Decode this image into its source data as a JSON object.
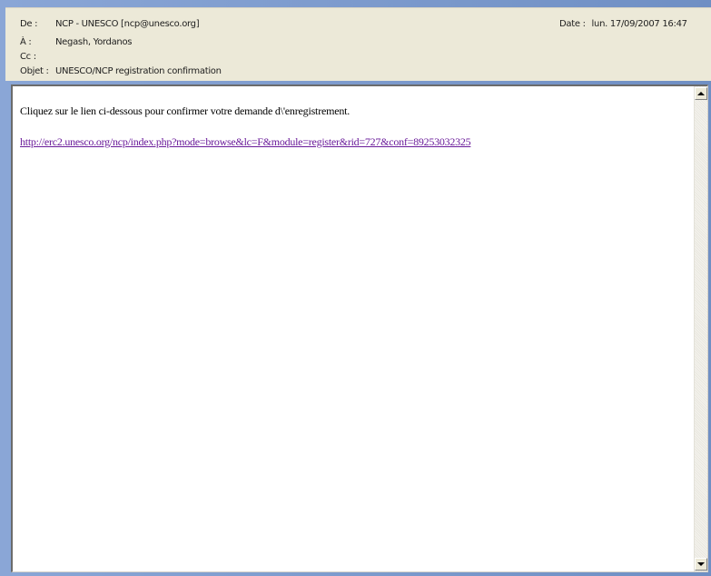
{
  "header": {
    "from_label": "De :",
    "from_value": "NCP - UNESCO [ncp@unesco.org]",
    "to_label": "À :",
    "to_value": "Negash, Yordanos",
    "cc_label": "Cc :",
    "cc_value": "",
    "subject_label": "Objet :",
    "subject_value": "UNESCO/NCP registration confirmation",
    "date_label": "Date :",
    "date_value": "lun. 17/09/2007 16:47"
  },
  "message": {
    "text": "Cliquez sur le lien ci-dessous pour confirmer votre demande d\\'enregistrement.",
    "link": "http://erc2.unesco.org/ncp/index.php?mode=browse&lc=F&module=register&rid=727&conf=89253032325"
  },
  "colors": {
    "link": "#6a1b9a",
    "header_bg": "#ece9d8"
  }
}
